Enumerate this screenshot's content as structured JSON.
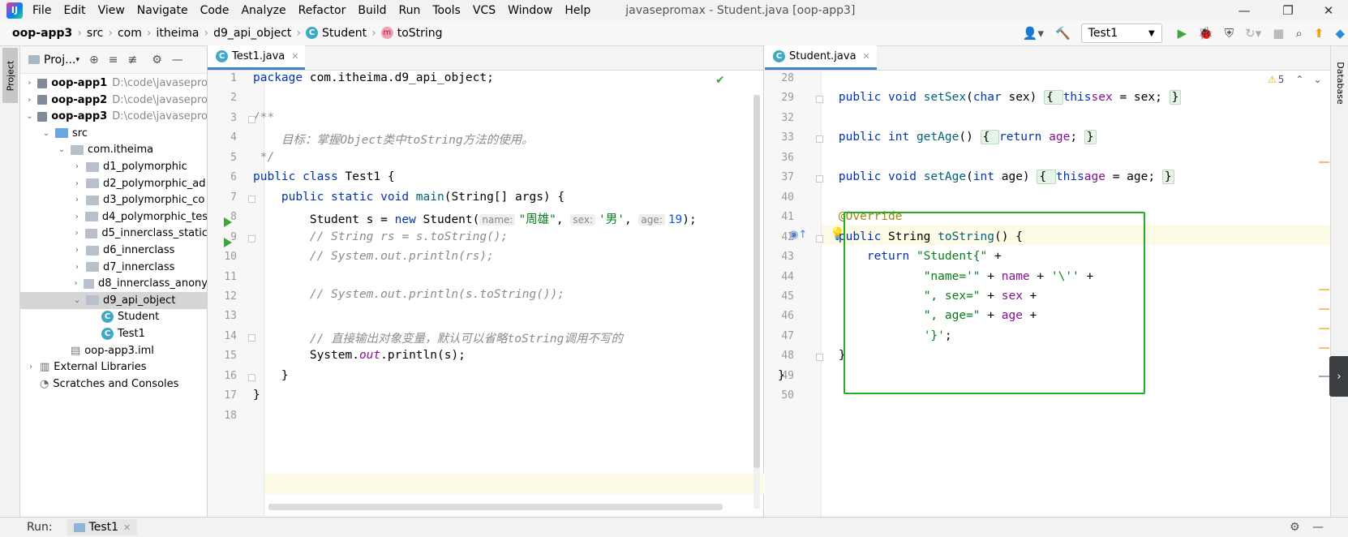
{
  "menubar": {
    "items": [
      "File",
      "Edit",
      "View",
      "Navigate",
      "Code",
      "Analyze",
      "Refactor",
      "Build",
      "Run",
      "Tools",
      "VCS",
      "Window",
      "Help"
    ],
    "window_title": "javasepromax - Student.java [oop-app3]"
  },
  "breadcrumb": [
    "oop-app3",
    "src",
    "com",
    "itheima",
    "d9_api_object",
    "Student",
    "toString"
  ],
  "toolbar": {
    "run_config": "Test1"
  },
  "project": {
    "title": "Proj...",
    "tree": [
      {
        "label": "oop-app1",
        "path": "D:\\code\\javasepro",
        "bold": true
      },
      {
        "label": "oop-app2",
        "path": "D:\\code\\javasepro",
        "bold": true
      },
      {
        "label": "oop-app3",
        "path": "D:\\code\\javasepro",
        "bold": true
      },
      {
        "label": "src"
      },
      {
        "label": "com.itheima"
      },
      {
        "label": "d1_polymorphic"
      },
      {
        "label": "d2_polymorphic_ad"
      },
      {
        "label": "d3_polymorphic_co"
      },
      {
        "label": "d4_polymorphic_tes"
      },
      {
        "label": "d5_innerclass_static"
      },
      {
        "label": "d6_innerclass"
      },
      {
        "label": "d7_innerclass"
      },
      {
        "label": "d8_innerclass_anony"
      },
      {
        "label": "d9_api_object"
      },
      {
        "label": "Student"
      },
      {
        "label": "Test1"
      },
      {
        "label": "oop-app3.iml"
      },
      {
        "label": "External Libraries"
      },
      {
        "label": "Scratches and Consoles"
      }
    ]
  },
  "editor1": {
    "tab": "Test1.java",
    "lines": [
      "1",
      "2",
      "3",
      "4",
      "5",
      "6",
      "7",
      "8",
      "9",
      "10",
      "11",
      "12",
      "13",
      "14",
      "15",
      "16",
      "17",
      "18"
    ],
    "code": {
      "l1a": "package ",
      "l1b": "com.itheima.d9_api_object;",
      "l3": "/**",
      "l4": "    目标：掌握Object类中toString方法的使用。",
      "l5": " */",
      "l6a": "public class ",
      "l6b": "Test1 {",
      "l7a": "    public static void ",
      "l7b": "main",
      "l7c": "(String[] args) {",
      "l8a": "        Student s = ",
      "l8b": "new ",
      "l8c": "Student(",
      "l8h1": "name:",
      "l8s1": "\"周雄\"",
      "l8c2": ", ",
      "l8h2": "sex:",
      "l8s2": "'男'",
      "l8c3": ", ",
      "l8h3": "age:",
      "l8n": "19",
      "l8e": ");",
      "l9": "        // String rs = s.toString();",
      "l10": "        // System.out.println(rs);",
      "l12": "        // System.out.println(s.toString());",
      "l14": "        // 直接输出对象变量，默认可以省略toString调用不写的",
      "l15a": "        System.",
      "l15b": "out",
      "l15c": ".println(s);",
      "l16": "    }",
      "l17": "}"
    }
  },
  "editor2": {
    "tab": "Student.java",
    "warnings": "5",
    "lines": [
      "28",
      "29",
      "32",
      "33",
      "36",
      "37",
      "40",
      "41",
      "42",
      "43",
      "44",
      "45",
      "46",
      "47",
      "48",
      "49",
      "50"
    ],
    "code": {
      "l29a": "    public void ",
      "l29b": "setSex",
      "l29c": "(",
      "l29d": "char ",
      "l29e": "sex) ",
      "l29f": "{ ",
      "l29g": "this",
      ".": ".",
      "l29h": "sex",
      " = ": " = sex; ",
      "l29i": "}",
      "l33a": "    public int ",
      "l33b": "getAge",
      "l33c": "() ",
      "l33d": "{ ",
      "l33e": "return ",
      "l33f": "age",
      "l33g": "; ",
      "l33h": "}",
      "l37a": "    public void ",
      "l37b": "setAge",
      "l37c": "(",
      "l37d": "int ",
      "l37e": "age) ",
      "l37f": "{ ",
      "l37g": "this",
      "l37h": "age",
      "l37i": " = age; ",
      "l37j": "}",
      "l41": "    @Override",
      "l42a": "    public ",
      "l42b": "String ",
      "l42c": "toString",
      "l42d": "() {",
      "l43a": "        return ",
      "l43b": "\"Student{\"",
      "l43c": " +",
      "l44a": "                ",
      "l44b": "\"name='\"",
      "l44c": " + ",
      "l44d": "name",
      "l44e": " + ",
      "l44f": "'\\''",
      "l44g": " +",
      "l45b": "\", sex=\"",
      "l45d": "sex",
      "l46b": "\", age=\"",
      "l46d": "age",
      "l47b": "'}'",
      "l47c": ";",
      "l48": "    }",
      "l49": "}"
    }
  },
  "sidebar": {
    "project_tab": "Project",
    "database_tab": "Database"
  },
  "bottom": {
    "run_label": "Run:",
    "run_tab": "Test1"
  }
}
